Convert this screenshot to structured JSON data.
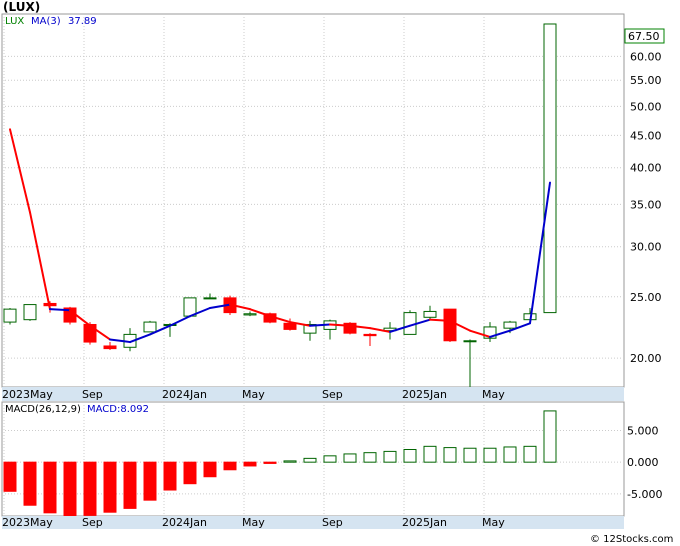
{
  "chart_data": [
    {
      "type": "candlestick",
      "title": "(LUX)",
      "legend": [
        {
          "label": "LUX",
          "color": "#008000"
        },
        {
          "label": "MA(3)",
          "color": "#0000cc"
        },
        {
          "label": "37.89",
          "color": "#0000cc"
        }
      ],
      "y_scale": "log",
      "ylim": [
        18,
        70
      ],
      "yticks": [
        20,
        25,
        30,
        35,
        40,
        45,
        50,
        55,
        60
      ],
      "ytick_labels": [
        "20.00",
        "25.00",
        "30.00",
        "35.00",
        "40.00",
        "45.00",
        "50.00",
        "55.00",
        "60.00"
      ],
      "last_price_label": "67.50",
      "x_labels": [
        {
          "label": "2023May",
          "index": 0
        },
        {
          "label": "Sep",
          "index": 4
        },
        {
          "label": "2024Jan",
          "index": 8
        },
        {
          "label": "May",
          "index": 12
        },
        {
          "label": "Sep",
          "index": 16
        },
        {
          "label": "2025Jan",
          "index": 20
        },
        {
          "label": "May",
          "index": 24
        }
      ],
      "series": [
        {
          "name": "LUX",
          "ohlc": [
            {
              "o": 22.8,
              "h": 24.0,
              "l": 22.6,
              "c": 23.9
            },
            {
              "o": 23.0,
              "h": 24.3,
              "l": 22.9,
              "c": 24.3
            },
            {
              "o": 24.4,
              "h": 24.6,
              "l": 23.6,
              "c": 24.2
            },
            {
              "o": 24.0,
              "h": 24.1,
              "l": 22.6,
              "c": 22.8
            },
            {
              "o": 22.6,
              "h": 22.8,
              "l": 21.0,
              "c": 21.2
            },
            {
              "o": 20.9,
              "h": 21.2,
              "l": 20.6,
              "c": 20.7
            },
            {
              "o": 20.8,
              "h": 22.3,
              "l": 20.5,
              "c": 21.8
            },
            {
              "o": 22.0,
              "h": 22.9,
              "l": 22.0,
              "c": 22.8
            },
            {
              "o": 22.6,
              "h": 22.7,
              "l": 21.6,
              "c": 22.6
            },
            {
              "o": 23.3,
              "h": 24.9,
              "l": 23.2,
              "c": 24.9
            },
            {
              "o": 24.9,
              "h": 25.3,
              "l": 24.8,
              "c": 24.9
            },
            {
              "o": 24.9,
              "h": 25.1,
              "l": 23.4,
              "c": 23.6
            },
            {
              "o": 23.4,
              "h": 23.7,
              "l": 23.3,
              "c": 23.5
            },
            {
              "o": 23.5,
              "h": 23.6,
              "l": 22.7,
              "c": 22.8
            },
            {
              "o": 22.7,
              "h": 23.1,
              "l": 22.1,
              "c": 22.2
            },
            {
              "o": 21.9,
              "h": 22.9,
              "l": 21.3,
              "c": 22.6
            },
            {
              "o": 22.2,
              "h": 23.0,
              "l": 21.4,
              "c": 22.9
            },
            {
              "o": 22.7,
              "h": 22.8,
              "l": 21.8,
              "c": 21.9
            },
            {
              "o": 21.8,
              "h": 21.9,
              "l": 20.9,
              "c": 21.7
            },
            {
              "o": 22.1,
              "h": 22.8,
              "l": 21.4,
              "c": 22.3
            },
            {
              "o": 21.8,
              "h": 23.8,
              "l": 21.8,
              "c": 23.6
            },
            {
              "o": 23.2,
              "h": 24.2,
              "l": 23.0,
              "c": 23.7
            },
            {
              "o": 23.9,
              "h": 23.9,
              "l": 21.2,
              "c": 21.3
            },
            {
              "o": 21.3,
              "h": 21.4,
              "l": 17.8,
              "c": 21.3
            },
            {
              "o": 21.5,
              "h": 22.8,
              "l": 21.2,
              "c": 22.4
            },
            {
              "o": 22.3,
              "h": 22.9,
              "l": 21.9,
              "c": 22.8
            },
            {
              "o": 23.0,
              "h": 24.0,
              "l": 22.8,
              "c": 23.5
            },
            {
              "o": 23.6,
              "h": 67.5,
              "l": 23.6,
              "c": 67.5
            }
          ],
          "up_color": "#006400",
          "down_color": "#ff0000"
        },
        {
          "name": "MA(3)",
          "values": [
            46,
            34,
            23.9,
            23.8,
            22.5,
            21.4,
            21.2,
            21.8,
            22.5,
            23.3,
            24.0,
            24.3,
            23.9,
            23.3,
            22.8,
            22.5,
            22.6,
            22.5,
            22.3,
            22.0,
            22.5,
            23.0,
            22.9,
            22.1,
            21.6,
            22.1,
            22.7,
            37.89
          ],
          "segment_colors": [
            "#ff0000",
            "#ff0000",
            "#0000cc",
            "#ff0000",
            "#ff0000",
            "#0000cc",
            "#0000cc",
            "#0000cc",
            "#0000cc",
            "#0000cc",
            "#0000cc",
            "#ff0000",
            "#ff0000",
            "#ff0000",
            "#ff0000",
            "#0000cc",
            "#ff0000",
            "#ff0000",
            "#ff0000",
            "#0000cc",
            "#0000cc",
            "#ff0000",
            "#ff0000",
            "#ff0000",
            "#0000cc",
            "#0000cc",
            "#0000cc"
          ]
        }
      ]
    },
    {
      "type": "bar",
      "legend": [
        {
          "label": "MACD(26,12,9)",
          "color": "#000000"
        },
        {
          "label": "MACD:8.092",
          "color": "#0000cc"
        }
      ],
      "ylim": [
        -8.5,
        9.5
      ],
      "yticks": [
        -5,
        0,
        5
      ],
      "ytick_labels": [
        "-5.000",
        "0.000",
        "5.000"
      ],
      "x_labels": [
        {
          "label": "2023May",
          "index": 0
        },
        {
          "label": "Sep",
          "index": 4
        },
        {
          "label": "2024Jan",
          "index": 8
        },
        {
          "label": "May",
          "index": 12
        },
        {
          "label": "Sep",
          "index": 16
        },
        {
          "label": "2025Jan",
          "index": 20
        },
        {
          "label": "May",
          "index": 24
        }
      ],
      "values": [
        -4.6,
        -6.8,
        -8.0,
        -8.6,
        -8.4,
        -7.9,
        -7.3,
        -6.0,
        -4.4,
        -3.4,
        -2.3,
        -1.2,
        -0.6,
        -0.2,
        0.2,
        0.6,
        1.0,
        1.3,
        1.5,
        1.7,
        2.0,
        2.5,
        2.3,
        2.2,
        2.2,
        2.4,
        2.5,
        8.092
      ],
      "pos_color": "#006400",
      "neg_color": "#ff0000"
    }
  ],
  "credit": "© 12Stocks.com"
}
